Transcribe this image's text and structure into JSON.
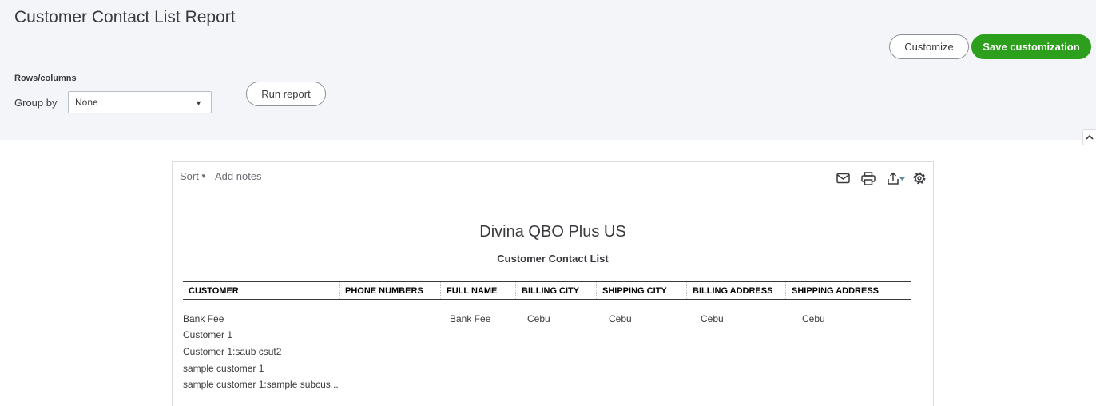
{
  "header": {
    "title": "Customer Contact List Report",
    "customize_label": "Customize",
    "save_label": "Save customization"
  },
  "filters": {
    "section_label": "Rows/columns",
    "group_by_label": "Group by",
    "group_by_value": "None",
    "run_label": "Run report"
  },
  "toolbar": {
    "sort_label": "Sort",
    "notes_label": "Add notes",
    "icons": [
      "mail-icon",
      "print-icon",
      "export-icon",
      "gear-icon"
    ]
  },
  "report": {
    "company": "Divina QBO Plus US",
    "name": "Customer Contact List",
    "columns": [
      "CUSTOMER",
      "PHONE NUMBERS",
      "FULL NAME",
      "BILLING CITY",
      "SHIPPING CITY",
      "BILLING ADDRESS",
      "SHIPPING ADDRESS"
    ],
    "rows": [
      {
        "customer": "Bank Fee",
        "phone": "",
        "full_name": "Bank Fee",
        "billing_city": "Cebu",
        "shipping_city": "Cebu",
        "billing_address": "Cebu",
        "shipping_address": "Cebu"
      },
      {
        "customer": "Customer 1",
        "phone": "",
        "full_name": "",
        "billing_city": "",
        "shipping_city": "",
        "billing_address": "",
        "shipping_address": ""
      },
      {
        "customer": "Customer 1:saub csut2",
        "phone": "",
        "full_name": "",
        "billing_city": "",
        "shipping_city": "",
        "billing_address": "",
        "shipping_address": ""
      },
      {
        "customer": "sample customer 1",
        "phone": "",
        "full_name": "",
        "billing_city": "",
        "shipping_city": "",
        "billing_address": "",
        "shipping_address": ""
      },
      {
        "customer": "sample customer 1:sample subcus...",
        "phone": "",
        "full_name": "",
        "billing_city": "",
        "shipping_city": "",
        "billing_address": "",
        "shipping_address": ""
      }
    ]
  },
  "colors": {
    "accent_green": "#2ca01c",
    "page_bg": "#f4f5f8",
    "text": "#393a3d"
  }
}
